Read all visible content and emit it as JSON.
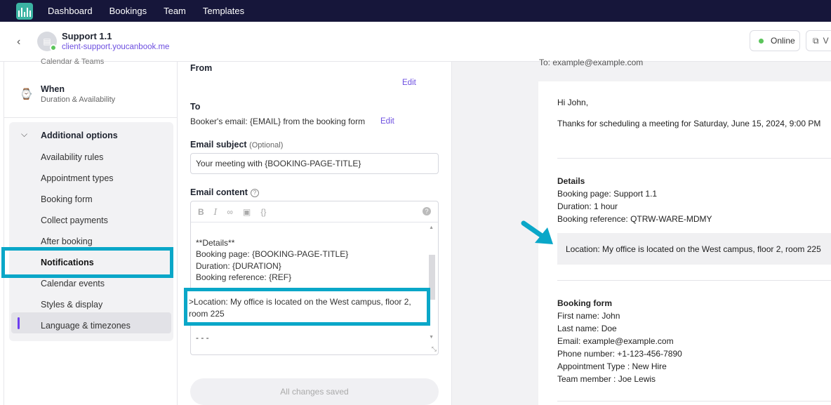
{
  "topnav": {
    "items": [
      "Dashboard",
      "Bookings",
      "Team",
      "Templates"
    ]
  },
  "header": {
    "title": "Support 1.1",
    "url": "client-support.youcanbook.me",
    "online_label": "Online",
    "view_label": "V"
  },
  "sidebar": {
    "cut_text": "Calendar & Teams",
    "when_title": "When",
    "when_sub": "Duration & Availability",
    "section_title": "Additional options",
    "items": [
      "Availability rules",
      "Appointment types",
      "Booking form",
      "Collect payments",
      "After booking",
      "Notifications",
      "Calendar events",
      "Styles & display",
      "Language & timezones"
    ],
    "active_item": "Notifications"
  },
  "editor": {
    "from_label": "From",
    "edit_label": "Edit",
    "to_label": "To",
    "to_text": "Booker's email: {EMAIL} from the booking form",
    "subject_label": "Email subject",
    "subject_optional": "(Optional)",
    "subject_value": "Your meeting with {BOOKING-PAGE-TITLE}",
    "content_label": "Email content",
    "content_lines": [
      "**Details**",
      "Booking page: {BOOKING-PAGE-TITLE}",
      "Duration: {DURATION}",
      "Booking reference: {REF}"
    ],
    "location_text": ">Location: My office is located on the West campus, floor 2, room 225",
    "trailing_text": "- - -",
    "save_label": "All changes saved"
  },
  "preview": {
    "to_cut": "To: example@example.com",
    "greeting": "Hi John,",
    "intro": "Thanks for scheduling a meeting for Saturday, June 15, 2024, 9:00 PM",
    "details_title": "Details",
    "details": [
      "Booking page: Support 1.1",
      "Duration: 1 hour",
      "Booking reference: QTRW-WARE-MDMY"
    ],
    "location": "Location: My office is located on the West campus, floor 2, room 225",
    "form_title": "Booking form",
    "form": [
      "First name: John",
      "Last name: Doe",
      "Email: example@example.com",
      "Phone number: +1-123-456-7890",
      "Appointment Type : New Hire",
      "Team member : Joe Lewis"
    ]
  },
  "colors": {
    "highlight": "#0aa7c8",
    "accent": "#6d4fe0",
    "nav_bg": "#16163a",
    "online": "#5bc45b"
  },
  "icons": [
    "logo-icon",
    "back-icon",
    "avatar-icon",
    "watch-icon",
    "chevron-down-icon",
    "bold-icon",
    "italic-icon",
    "link-icon",
    "image-icon",
    "code-icon",
    "help-icon",
    "external-link-icon",
    "arrow-annotation-icon"
  ]
}
